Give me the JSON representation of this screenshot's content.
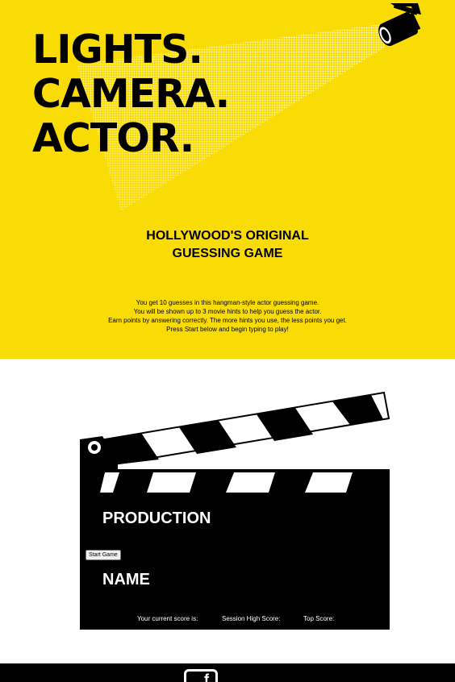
{
  "hero": {
    "headline": [
      "LIGHTS.",
      "CAMERA.",
      "ACTOR."
    ],
    "subtitle_line1": "HOLLYWOOD'S ORIGINAL",
    "subtitle_line2": "GUESSING GAME",
    "intro_lines": [
      "You get 10 guesses in this hangman-style actor guessing game.",
      "You will be shown up to 3 movie hints to help you guess the actor.",
      "Earn points by answering correctly. The more hints you use, the less points you get.",
      "Press Start below and begin typing to play!"
    ],
    "background_color": "#f9dc05"
  },
  "clapperboard": {
    "production_label": "PRODUCTION",
    "name_label": "NAME",
    "start_button_label": "Start Game"
  },
  "scores": {
    "current_label": "Your current score is:",
    "session_high_label": "Session High Score:",
    "top_label": "Top Score:"
  },
  "footer": {
    "icon": "facebook-icon",
    "icon_glyph": "f"
  }
}
